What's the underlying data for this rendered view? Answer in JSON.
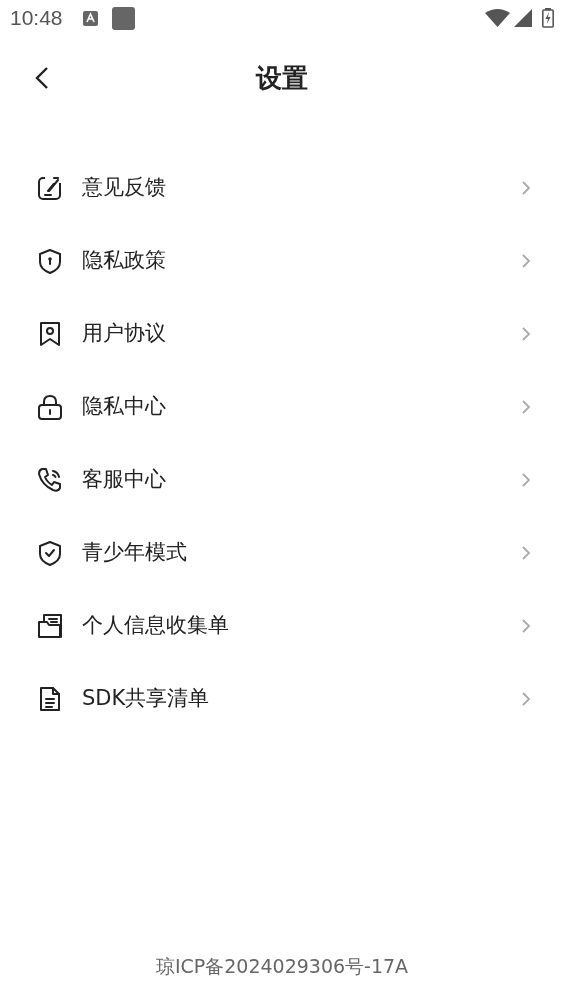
{
  "status_bar": {
    "time": "10:48"
  },
  "header": {
    "title": "设置"
  },
  "items": [
    {
      "label": "意见反馈"
    },
    {
      "label": "隐私政策"
    },
    {
      "label": "用户协议"
    },
    {
      "label": "隐私中心"
    },
    {
      "label": "客服中心"
    },
    {
      "label": "青少年模式"
    },
    {
      "label": "个人信息收集单"
    },
    {
      "label": "SDK共享清单"
    }
  ],
  "footer": {
    "text": "琼ICP备2024029306号-17A"
  }
}
